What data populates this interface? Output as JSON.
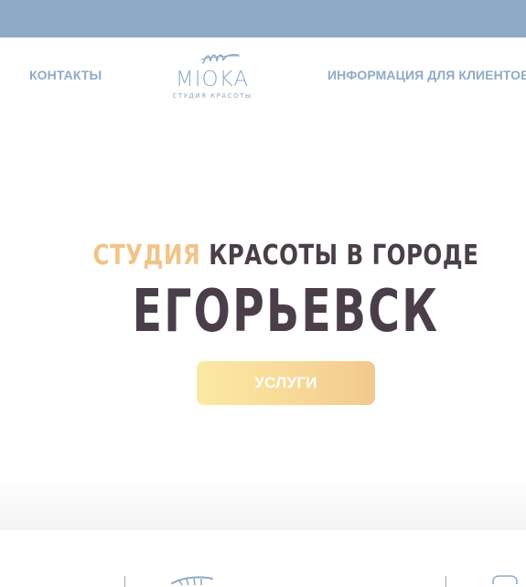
{
  "colors": {
    "topbar": "#8eaac7",
    "nav_text": "#8eaac7",
    "accent": "#f0c48a",
    "dark_text": "#4a3f48",
    "button_gradient": [
      "#fbe9a3",
      "#f2c98f"
    ]
  },
  "header": {
    "nav_left": "КОНТАКТЫ",
    "nav_right": "ИНФОРМАЦИЯ ДЛЯ КЛИЕНТОВ",
    "logo": {
      "word": "MIOKA",
      "tagline": "СТУДИЯ КРАСОТЫ",
      "icon": "brush-stroke-logo-icon"
    }
  },
  "hero": {
    "headline_accent": "СТУДИЯ",
    "headline_rest": " КРАСОТЫ В ГОРОДЕ",
    "city": "ЕГОРЬЕВСК",
    "button_label": "УСЛУГИ"
  },
  "bottom": {
    "icons": [
      "comb-icon",
      "mirror-icon"
    ]
  }
}
